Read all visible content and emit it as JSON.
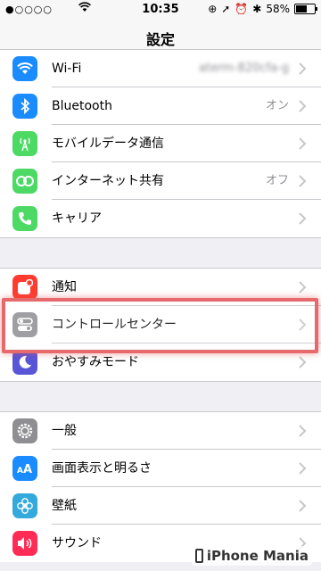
{
  "status_bar": {
    "signal": "●○○○○",
    "time": "10:35",
    "battery": "58%",
    "battery_level": 0.58
  },
  "nav": {
    "title": "設定"
  },
  "groups": [
    {
      "items": [
        {
          "label": "Wi-Fi",
          "value": "aterm-820cfa-g",
          "icon": "wifi-icon",
          "color": "#1a8cff"
        },
        {
          "label": "Bluetooth",
          "value": "オン",
          "icon": "bluetooth-icon",
          "color": "#1a8cff"
        },
        {
          "label": "モバイルデータ通信",
          "value": "",
          "icon": "cellular-icon",
          "color": "#4cd964"
        },
        {
          "label": "インターネット共有",
          "value": "オフ",
          "icon": "hotspot-icon",
          "color": "#4cd964"
        },
        {
          "label": "キャリア",
          "value": "",
          "icon": "phone-icon",
          "color": "#4cd964"
        }
      ]
    },
    {
      "items": [
        {
          "label": "通知",
          "value": "",
          "icon": "notifications-icon",
          "color": "#ff3b30"
        },
        {
          "label": "コントロールセンター",
          "value": "",
          "icon": "control-center-icon",
          "color": "#8e8e93"
        },
        {
          "label": "おやすみモード",
          "value": "",
          "icon": "moon-icon",
          "color": "#5856d6"
        }
      ]
    },
    {
      "items": [
        {
          "label": "一般",
          "value": "",
          "icon": "gear-icon",
          "color": "#8e8e93"
        },
        {
          "label": "画面表示と明るさ",
          "value": "",
          "icon": "display-icon",
          "color": "#1a8cff"
        },
        {
          "label": "壁紙",
          "value": "",
          "icon": "wallpaper-icon",
          "color": "#34aadc"
        },
        {
          "label": "サウンド",
          "value": "",
          "icon": "sound-icon",
          "color": "#ff2d55"
        }
      ]
    }
  ],
  "watermark": {
    "text": "iPhone Mania"
  }
}
